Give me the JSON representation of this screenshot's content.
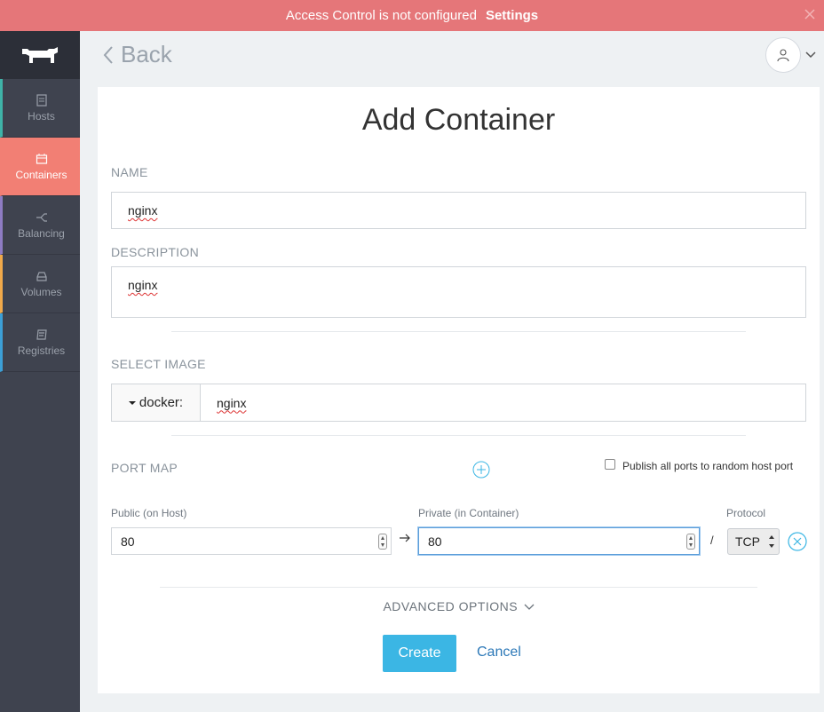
{
  "banner": {
    "message": "Access Control is not configured",
    "link": "Settings"
  },
  "sidebar": {
    "items": [
      {
        "label": "Hosts",
        "icon": "hosts-icon",
        "accent": "#3fb3a8"
      },
      {
        "label": "Containers",
        "icon": "containers-icon",
        "accent": "#f27f74"
      },
      {
        "label": "Balancing",
        "icon": "balancing-icon",
        "accent": "#8e7cc3"
      },
      {
        "label": "Volumes",
        "icon": "volumes-icon",
        "accent": "#f0a94a"
      },
      {
        "label": "Registries",
        "icon": "registries-icon",
        "accent": "#3c9fd6"
      }
    ]
  },
  "header": {
    "back": "Back"
  },
  "form": {
    "title": "Add Container",
    "name_label": "NAME",
    "name_value": "nginx",
    "description_label": "DESCRIPTION",
    "description_value": "nginx",
    "image_label": "SELECT IMAGE",
    "image_source": "docker:",
    "image_value": "nginx",
    "port_map_label": "PORT MAP",
    "publish_all_label": "Publish all ports to random host port",
    "public_label": "Public (on Host)",
    "public_value": "80",
    "private_label": "Private (in Container)",
    "private_value": "80",
    "protocol_label": "Protocol",
    "protocol_value": "TCP",
    "separator": "/",
    "advanced_options": "ADVANCED OPTIONS",
    "create": "Create",
    "cancel": "Cancel"
  },
  "colors": {
    "banner": "#e57679",
    "sidebar": "#3f434f",
    "active": "#f27f74",
    "primary": "#3bb6e4",
    "link": "#2d79b8"
  }
}
